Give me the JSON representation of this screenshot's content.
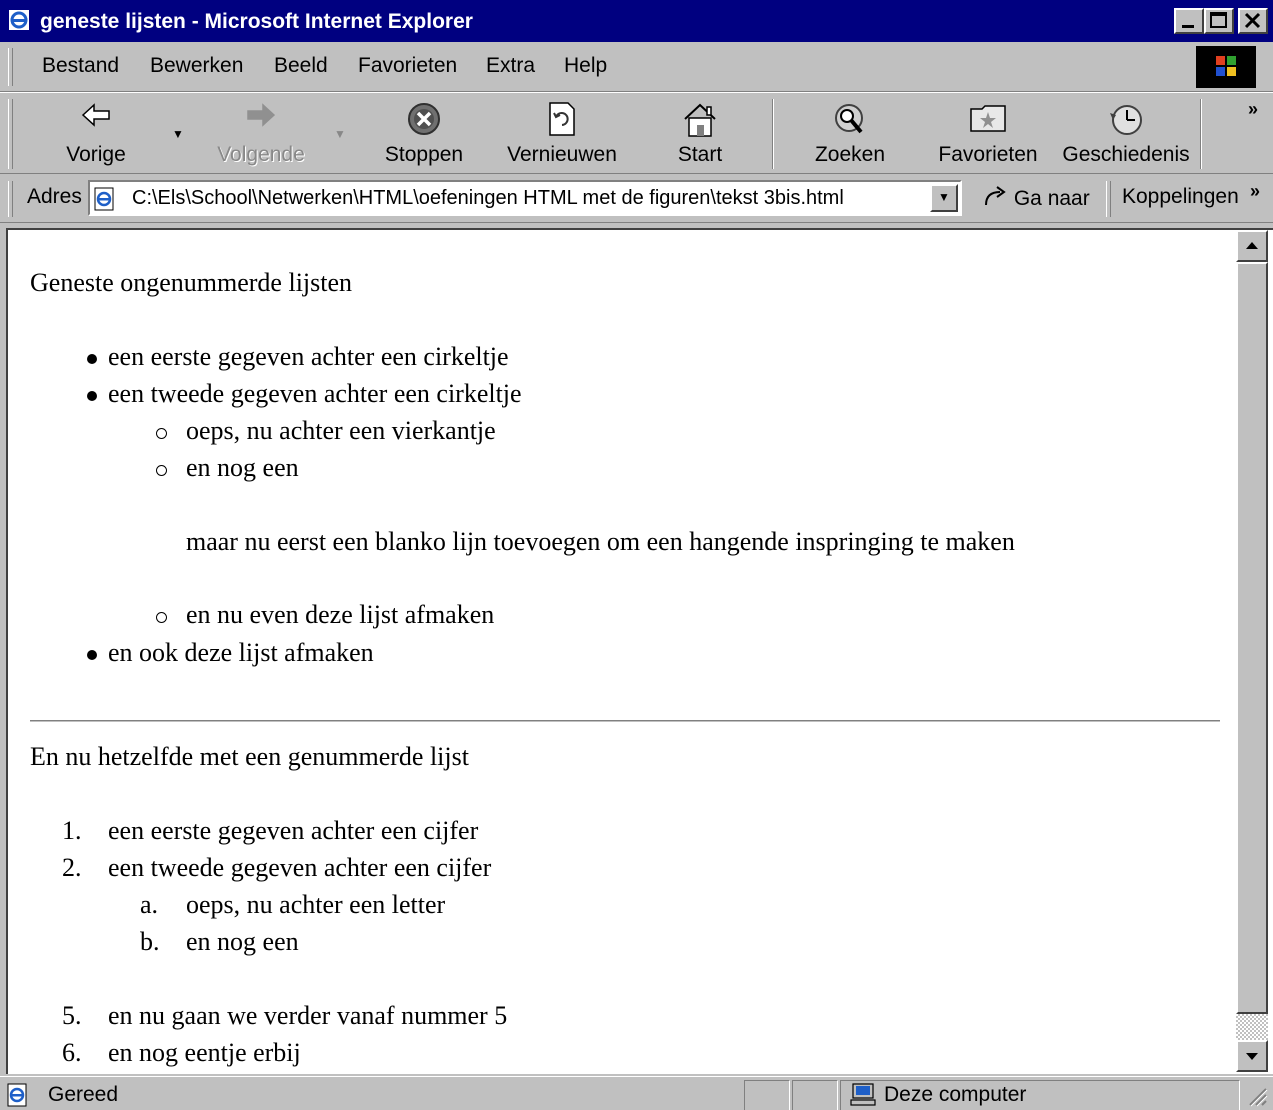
{
  "window": {
    "title": "geneste lijsten - Microsoft Internet Explorer"
  },
  "menu": {
    "items": [
      "Bestand",
      "Bewerken",
      "Beeld",
      "Favorieten",
      "Extra",
      "Help"
    ]
  },
  "toolbar": {
    "back": "Vorige",
    "forward": "Volgende",
    "stop": "Stoppen",
    "refresh": "Vernieuwen",
    "home": "Start",
    "search": "Zoeken",
    "favorites": "Favorieten",
    "history": "Geschiedenis",
    "more": "»"
  },
  "address": {
    "label": "Adres",
    "value": "C:\\Els\\School\\Netwerken\\HTML\\oefeningen HTML met de figuren\\tekst 3bis.html",
    "go": "Ga naar",
    "links": "Koppelingen",
    "links_more": "»"
  },
  "content": {
    "heading1": "Geneste ongenummerde lijsten",
    "ul": {
      "item1": "een eerste gegeven achter een cirkeltje",
      "item2": "een tweede gegeven achter een cirkeltje",
      "sub1": "oeps, nu achter een vierkantje",
      "sub2": "en nog een",
      "blank_line": "maar nu eerst een blanko lijn toevoegen om een hangende inspringing te maken",
      "sub3": "en nu even deze lijst afmaken",
      "item3": "en ook deze lijst afmaken"
    },
    "heading2": "En nu hetzelfde met een genummerde lijst",
    "ol": {
      "m1": "1.",
      "item1": "een eerste gegeven achter een cijfer",
      "m2": "2.",
      "item2": "een tweede gegeven achter een cijfer",
      "ma": "a.",
      "sub1": "oeps, nu achter een letter",
      "mb": "b.",
      "sub2": "en nog een",
      "m5": "5.",
      "item5": "en nu gaan we verder vanaf nummer 5",
      "m6": "6.",
      "item6": "en nog eentje erbij"
    }
  },
  "status": {
    "text": "Gereed",
    "zone": "Deze computer"
  }
}
